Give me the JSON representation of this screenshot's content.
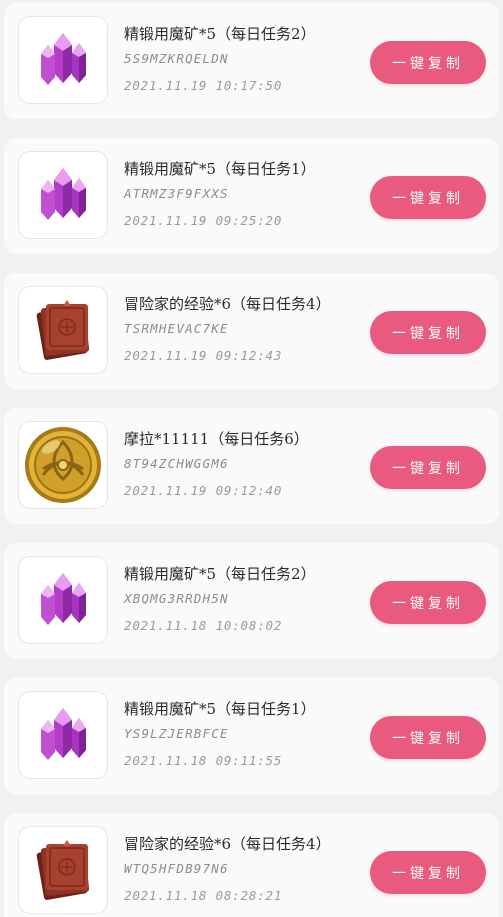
{
  "copy_button_label": "一键复制",
  "colors": {
    "button": "#ea5a7e",
    "card": "#fafafa",
    "background": "#f1f1f1"
  },
  "items": [
    {
      "icon": "magic-crystal-icon",
      "title": "精锻用魔矿*5（每日任务2）",
      "code": "5S9MZKRQELDN",
      "time": "2021.11.19 10:17:50"
    },
    {
      "icon": "magic-crystal-icon",
      "title": "精锻用魔矿*5（每日任务1）",
      "code": "ATRMZ3F9FXXS",
      "time": "2021.11.19 09:25:20"
    },
    {
      "icon": "exp-book-icon",
      "title": "冒险家的经验*6（每日任务4）",
      "code": "TSRMHEVAC7KE",
      "time": "2021.11.19 09:12:43"
    },
    {
      "icon": "mora-coin-icon",
      "title": "摩拉*11111（每日任务6）",
      "code": "8T94ZCHWGGM6",
      "time": "2021.11.19 09:12:40"
    },
    {
      "icon": "magic-crystal-icon",
      "title": "精锻用魔矿*5（每日任务2）",
      "code": "XBQMG3RRDH5N",
      "time": "2021.11.18 10:08:02"
    },
    {
      "icon": "magic-crystal-icon",
      "title": "精锻用魔矿*5（每日任务1）",
      "code": "YS9LZJERBFCE",
      "time": "2021.11.18 09:11:55"
    },
    {
      "icon": "exp-book-icon",
      "title": "冒险家的经验*6（每日任务4）",
      "code": "WTQ5HFDB97N6",
      "time": "2021.11.18 08:28:21"
    }
  ]
}
